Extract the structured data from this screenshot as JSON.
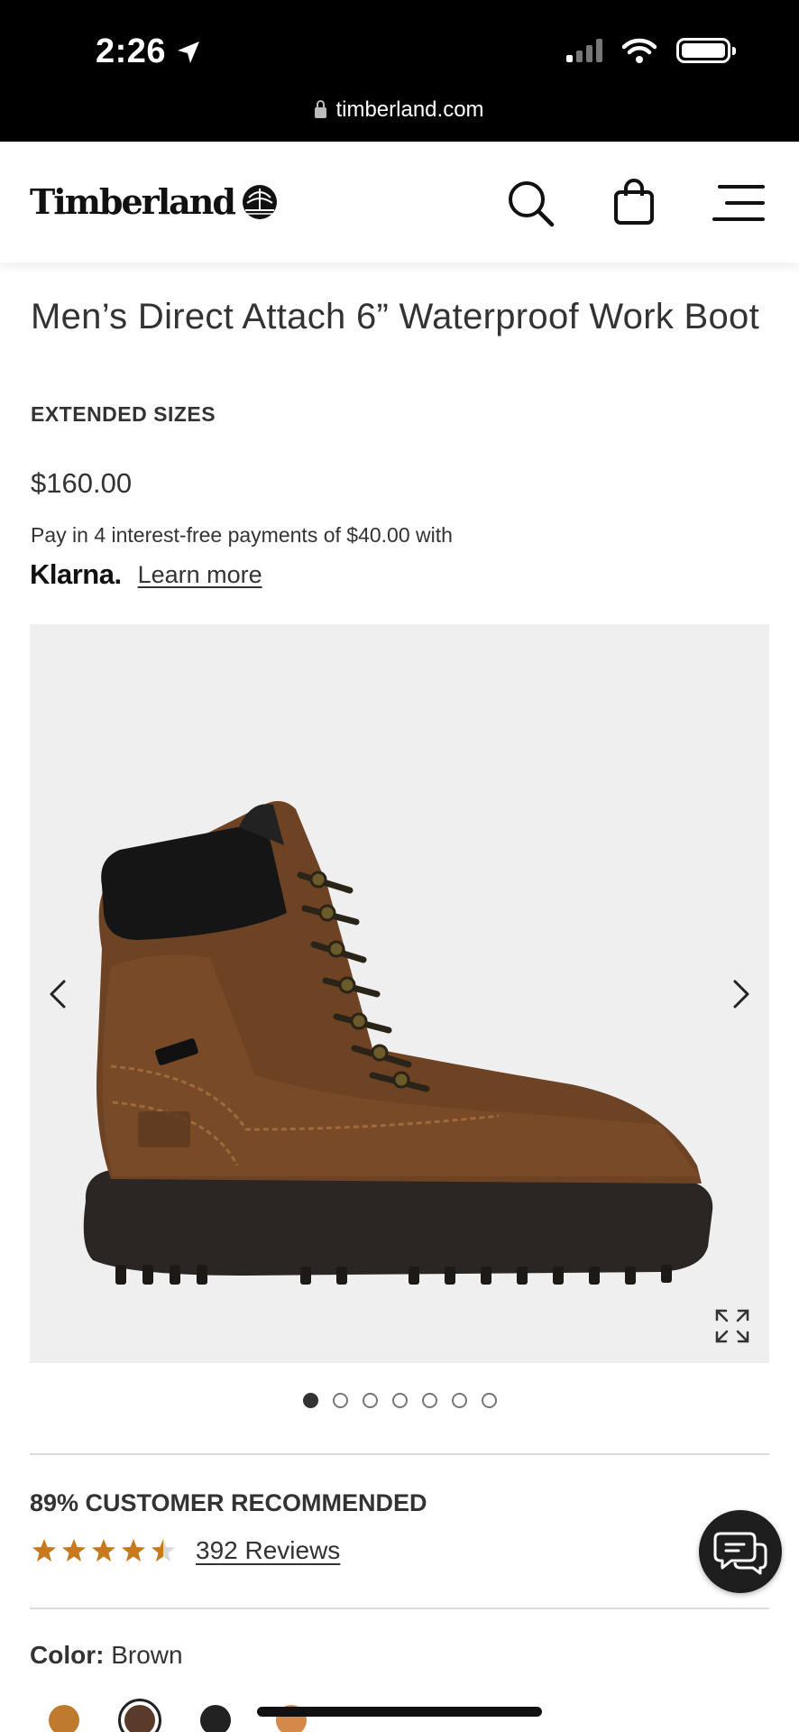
{
  "status_bar": {
    "time": "2:26"
  },
  "url_bar": {
    "domain": "timberland.com"
  },
  "header": {
    "logo_text": "Timberland"
  },
  "product": {
    "title": "Men’s Direct Attach 6” Waterproof Work Boot",
    "tag": "EXTENDED SIZES",
    "price": "$160.00",
    "pay_text": "Pay in 4 interest-free payments of $40.00 with",
    "klarna_logo": "Klarna.",
    "learn_more": "Learn more"
  },
  "carousel": {
    "image_count": 7,
    "active_index": 0
  },
  "rating": {
    "recommended": "89% CUSTOMER RECOMMENDED",
    "stars": 4.5,
    "reviews_label": "392 Reviews"
  },
  "color": {
    "label": "Color:",
    "value": "Brown",
    "swatches": [
      "#c07a2e",
      "#5a3a28",
      "#222222",
      "#d4894a"
    ]
  },
  "colors": {
    "accent_star": "#c8791e",
    "bg_dark": "#000000"
  }
}
